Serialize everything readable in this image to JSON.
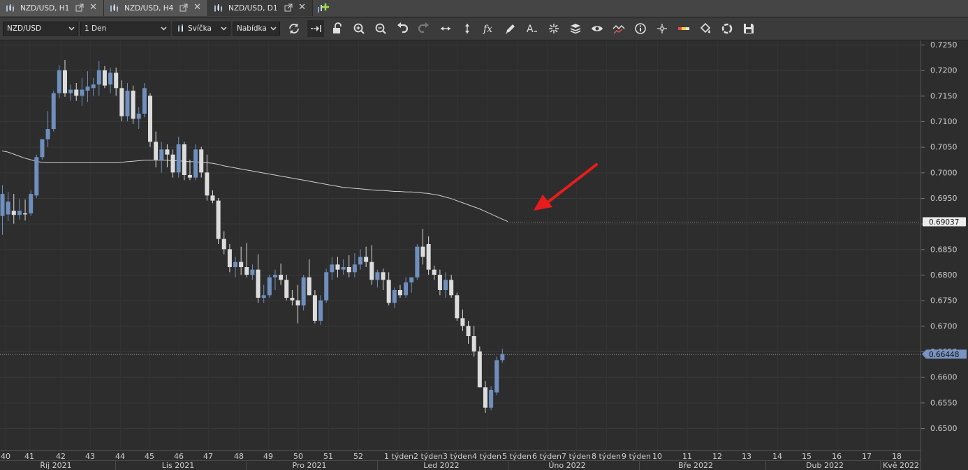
{
  "tabs": [
    {
      "label": "NZD/USD, H1",
      "active": false
    },
    {
      "label": "NZD/USD, H4",
      "active": false
    },
    {
      "label": "NZD/USD, D1",
      "active": true
    }
  ],
  "toolbar": {
    "symbol": "NZD/USD",
    "timeframe": "1 Den",
    "chart_type": "Svíčka",
    "offer": "Nabídka",
    "icons": [
      "refresh-icon",
      "autoscroll-icon",
      "unlock-icon",
      "zoom-in-icon",
      "zoom-out-icon",
      "undo-icon",
      "redo-icon",
      "horizontal-resize-icon",
      "vertical-resize-icon",
      "function-icon",
      "pencil-icon",
      "text-tool-icon",
      "crosshair-tool-icon",
      "layers-icon",
      "eye-icon",
      "indicator-icon",
      "info-icon",
      "cursor-icon",
      "color-bar-icon",
      "paint-bucket-icon",
      "template-icon",
      "save-icon"
    ]
  },
  "chart_data": {
    "type": "candlestick",
    "symbol": "NZD/USD",
    "timeframe": "D1",
    "ylim": [
      0.6485,
      0.7255
    ],
    "y_ticks": [
      "0.7250",
      "0.7200",
      "0.7150",
      "0.7100",
      "0.7050",
      "0.7000",
      "0.6950",
      "0.6900",
      "0.6850",
      "0.6800",
      "0.6750",
      "0.6700",
      "0.6650",
      "0.6600",
      "0.6550",
      "0.6500"
    ],
    "price_labels": {
      "ma_value": "0.69037",
      "last_price": "0.66448"
    },
    "week_labels": [
      "40",
      "41",
      "42",
      "43",
      "44",
      "45",
      "46",
      "47",
      "48",
      "49",
      "50",
      "51",
      "52",
      "1 týden",
      "2 týden",
      "3 týden",
      "4 týden",
      "5 týden",
      "6 týden",
      "7 týden",
      "8 týden",
      "9 týden",
      "10",
      "11",
      "12",
      "13",
      "14",
      "15",
      "16",
      "17",
      "18"
    ],
    "month_labels": [
      "Říj 2021",
      "Lis 2021",
      "Pro 2021",
      "Led 2022",
      "Úno 2022",
      "Bře 2022",
      "Dub 2022",
      "Kvě 2022"
    ],
    "colors": {
      "bull": "#6f8fbf",
      "bear": "#dcdcdc",
      "ma": "#cfcfcf",
      "arrow": "#e81c1c",
      "background": "#2d2d2d"
    },
    "candles": [
      {
        "o": 0.6915,
        "h": 0.6975,
        "l": 0.6878,
        "c": 0.6958
      },
      {
        "o": 0.6918,
        "h": 0.6962,
        "l": 0.6905,
        "c": 0.6943
      },
      {
        "o": 0.6925,
        "h": 0.6958,
        "l": 0.69,
        "c": 0.6917
      },
      {
        "o": 0.6917,
        "h": 0.6948,
        "l": 0.6908,
        "c": 0.6925
      },
      {
        "o": 0.692,
        "h": 0.6947,
        "l": 0.6906,
        "c": 0.6918
      },
      {
        "o": 0.692,
        "h": 0.6965,
        "l": 0.6915,
        "c": 0.6958
      },
      {
        "o": 0.6955,
        "h": 0.7035,
        "l": 0.695,
        "c": 0.703
      },
      {
        "o": 0.703,
        "h": 0.7065,
        "l": 0.7025,
        "c": 0.7065
      },
      {
        "o": 0.7065,
        "h": 0.712,
        "l": 0.705,
        "c": 0.7085
      },
      {
        "o": 0.7085,
        "h": 0.716,
        "l": 0.708,
        "c": 0.7155
      },
      {
        "o": 0.7155,
        "h": 0.721,
        "l": 0.7145,
        "c": 0.72
      },
      {
        "o": 0.72,
        "h": 0.722,
        "l": 0.7148,
        "c": 0.7155
      },
      {
        "o": 0.7155,
        "h": 0.7172,
        "l": 0.714,
        "c": 0.7162
      },
      {
        "o": 0.7162,
        "h": 0.7175,
        "l": 0.714,
        "c": 0.715
      },
      {
        "o": 0.715,
        "h": 0.7185,
        "l": 0.713,
        "c": 0.7162
      },
      {
        "o": 0.716,
        "h": 0.7198,
        "l": 0.7138,
        "c": 0.7168
      },
      {
        "o": 0.7165,
        "h": 0.7185,
        "l": 0.715,
        "c": 0.7172
      },
      {
        "o": 0.7172,
        "h": 0.7218,
        "l": 0.715,
        "c": 0.72
      },
      {
        "o": 0.72,
        "h": 0.7208,
        "l": 0.7165,
        "c": 0.717
      },
      {
        "o": 0.7172,
        "h": 0.7205,
        "l": 0.7155,
        "c": 0.7195
      },
      {
        "o": 0.7195,
        "h": 0.7205,
        "l": 0.715,
        "c": 0.7165
      },
      {
        "o": 0.7165,
        "h": 0.718,
        "l": 0.71,
        "c": 0.711
      },
      {
        "o": 0.711,
        "h": 0.7175,
        "l": 0.71,
        "c": 0.716
      },
      {
        "o": 0.716,
        "h": 0.717,
        "l": 0.7095,
        "c": 0.7105
      },
      {
        "o": 0.7105,
        "h": 0.7128,
        "l": 0.7085,
        "c": 0.7115
      },
      {
        "o": 0.7115,
        "h": 0.7175,
        "l": 0.7108,
        "c": 0.7165
      },
      {
        "o": 0.715,
        "h": 0.7155,
        "l": 0.705,
        "c": 0.706
      },
      {
        "o": 0.706,
        "h": 0.708,
        "l": 0.701,
        "c": 0.7025
      },
      {
        "o": 0.7025,
        "h": 0.706,
        "l": 0.7,
        "c": 0.7045
      },
      {
        "o": 0.7045,
        "h": 0.7055,
        "l": 0.701,
        "c": 0.7035
      },
      {
        "o": 0.7035,
        "h": 0.7045,
        "l": 0.699,
        "c": 0.7
      },
      {
        "o": 0.7,
        "h": 0.707,
        "l": 0.699,
        "c": 0.7055
      },
      {
        "o": 0.7055,
        "h": 0.706,
        "l": 0.6985,
        "c": 0.6995
      },
      {
        "o": 0.6995,
        "h": 0.7025,
        "l": 0.6985,
        "c": 0.699
      },
      {
        "o": 0.699,
        "h": 0.7055,
        "l": 0.6985,
        "c": 0.7045
      },
      {
        "o": 0.7045,
        "h": 0.705,
        "l": 0.699,
        "c": 0.7
      },
      {
        "o": 0.7,
        "h": 0.7035,
        "l": 0.6945,
        "c": 0.6955
      },
      {
        "o": 0.6955,
        "h": 0.6965,
        "l": 0.694,
        "c": 0.6945
      },
      {
        "o": 0.6945,
        "h": 0.695,
        "l": 0.686,
        "c": 0.687
      },
      {
        "o": 0.687,
        "h": 0.6885,
        "l": 0.684,
        "c": 0.685
      },
      {
        "o": 0.685,
        "h": 0.686,
        "l": 0.6805,
        "c": 0.6815
      },
      {
        "o": 0.6815,
        "h": 0.6835,
        "l": 0.6795,
        "c": 0.6825
      },
      {
        "o": 0.6825,
        "h": 0.6855,
        "l": 0.68,
        "c": 0.6815
      },
      {
        "o": 0.6815,
        "h": 0.6862,
        "l": 0.6795,
        "c": 0.68
      },
      {
        "o": 0.68,
        "h": 0.682,
        "l": 0.679,
        "c": 0.681
      },
      {
        "o": 0.681,
        "h": 0.684,
        "l": 0.6745,
        "c": 0.6755
      },
      {
        "o": 0.6755,
        "h": 0.678,
        "l": 0.6745,
        "c": 0.676
      },
      {
        "o": 0.676,
        "h": 0.68,
        "l": 0.6755,
        "c": 0.6795
      },
      {
        "o": 0.6795,
        "h": 0.681,
        "l": 0.677,
        "c": 0.68
      },
      {
        "o": 0.68,
        "h": 0.6822,
        "l": 0.678,
        "c": 0.679
      },
      {
        "o": 0.679,
        "h": 0.68,
        "l": 0.675,
        "c": 0.6755
      },
      {
        "o": 0.6755,
        "h": 0.677,
        "l": 0.674,
        "c": 0.675
      },
      {
        "o": 0.675,
        "h": 0.678,
        "l": 0.6705,
        "c": 0.674
      },
      {
        "o": 0.674,
        "h": 0.68,
        "l": 0.673,
        "c": 0.6795
      },
      {
        "o": 0.6795,
        "h": 0.683,
        "l": 0.676,
        "c": 0.676
      },
      {
        "o": 0.676,
        "h": 0.677,
        "l": 0.6705,
        "c": 0.671
      },
      {
        "o": 0.671,
        "h": 0.676,
        "l": 0.6702,
        "c": 0.675
      },
      {
        "o": 0.675,
        "h": 0.6812,
        "l": 0.6745,
        "c": 0.6805
      },
      {
        "o": 0.6805,
        "h": 0.6835,
        "l": 0.679,
        "c": 0.682
      },
      {
        "o": 0.682,
        "h": 0.6835,
        "l": 0.6795,
        "c": 0.681
      },
      {
        "o": 0.681,
        "h": 0.683,
        "l": 0.68,
        "c": 0.6815
      },
      {
        "o": 0.6815,
        "h": 0.6838,
        "l": 0.6795,
        "c": 0.6805
      },
      {
        "o": 0.6805,
        "h": 0.6842,
        "l": 0.6795,
        "c": 0.682
      },
      {
        "o": 0.682,
        "h": 0.685,
        "l": 0.681,
        "c": 0.6835
      },
      {
        "o": 0.6835,
        "h": 0.6855,
        "l": 0.6815,
        "c": 0.6825
      },
      {
        "o": 0.6825,
        "h": 0.6858,
        "l": 0.678,
        "c": 0.679
      },
      {
        "o": 0.679,
        "h": 0.681,
        "l": 0.6775,
        "c": 0.6805
      },
      {
        "o": 0.6805,
        "h": 0.6812,
        "l": 0.677,
        "c": 0.679
      },
      {
        "o": 0.679,
        "h": 0.6805,
        "l": 0.674,
        "c": 0.6745
      },
      {
        "o": 0.6745,
        "h": 0.6775,
        "l": 0.6735,
        "c": 0.677
      },
      {
        "o": 0.677,
        "h": 0.678,
        "l": 0.6755,
        "c": 0.676
      },
      {
        "o": 0.676,
        "h": 0.6795,
        "l": 0.6755,
        "c": 0.6785
      },
      {
        "o": 0.6785,
        "h": 0.6795,
        "l": 0.6765,
        "c": 0.6795
      },
      {
        "o": 0.6795,
        "h": 0.686,
        "l": 0.679,
        "c": 0.6855
      },
      {
        "o": 0.6855,
        "h": 0.689,
        "l": 0.682,
        "c": 0.6835
      },
      {
        "o": 0.686,
        "h": 0.6875,
        "l": 0.68,
        "c": 0.681
      },
      {
        "o": 0.681,
        "h": 0.6818,
        "l": 0.679,
        "c": 0.68
      },
      {
        "o": 0.68,
        "h": 0.681,
        "l": 0.676,
        "c": 0.677
      },
      {
        "o": 0.677,
        "h": 0.6805,
        "l": 0.6755,
        "c": 0.679
      },
      {
        "o": 0.679,
        "h": 0.68,
        "l": 0.6755,
        "c": 0.676
      },
      {
        "o": 0.676,
        "h": 0.6765,
        "l": 0.671,
        "c": 0.6715
      },
      {
        "o": 0.6715,
        "h": 0.6732,
        "l": 0.669,
        "c": 0.67
      },
      {
        "o": 0.67,
        "h": 0.671,
        "l": 0.6665,
        "c": 0.668
      },
      {
        "o": 0.668,
        "h": 0.67,
        "l": 0.664,
        "c": 0.665
      },
      {
        "o": 0.665,
        "h": 0.666,
        "l": 0.658,
        "c": 0.658
      },
      {
        "o": 0.658,
        "h": 0.6592,
        "l": 0.653,
        "c": 0.654
      },
      {
        "o": 0.654,
        "h": 0.6582,
        "l": 0.6535,
        "c": 0.6575
      },
      {
        "o": 0.657,
        "h": 0.664,
        "l": 0.6565,
        "c": 0.6633
      },
      {
        "o": 0.6633,
        "h": 0.6655,
        "l": 0.6628,
        "c": 0.6645
      }
    ],
    "ma": [
      0.7042,
      0.704,
      0.7036,
      0.7032,
      0.7028,
      0.7025,
      0.7022,
      0.702,
      0.7019,
      0.7019,
      0.7019,
      0.7019,
      0.7019,
      0.7019,
      0.7019,
      0.7019,
      0.7019,
      0.7019,
      0.7019,
      0.7019,
      0.7019,
      0.702,
      0.7021,
      0.7022,
      0.7023,
      0.7024,
      0.7024,
      0.7024,
      0.7024,
      0.7024,
      0.7023,
      0.7023,
      0.7022,
      0.7021,
      0.7021,
      0.702,
      0.7019,
      0.7018,
      0.7016,
      0.7013,
      0.7011,
      0.7009,
      0.7007,
      0.7005,
      0.7003,
      0.7001,
      0.6999,
      0.6997,
      0.6995,
      0.6993,
      0.6991,
      0.6989,
      0.6987,
      0.6985,
      0.6983,
      0.6981,
      0.6979,
      0.6977,
      0.6975,
      0.6973,
      0.6971,
      0.697,
      0.6969,
      0.6968,
      0.6967,
      0.6966,
      0.6965,
      0.6965,
      0.6964,
      0.6963,
      0.6963,
      0.6962,
      0.6962,
      0.6961,
      0.696,
      0.6959,
      0.6957,
      0.6955,
      0.6952,
      0.6949,
      0.6945,
      0.6941,
      0.6937,
      0.6933,
      0.6929,
      0.6924,
      0.6919,
      0.6914,
      0.6909,
      0.6904
    ]
  }
}
